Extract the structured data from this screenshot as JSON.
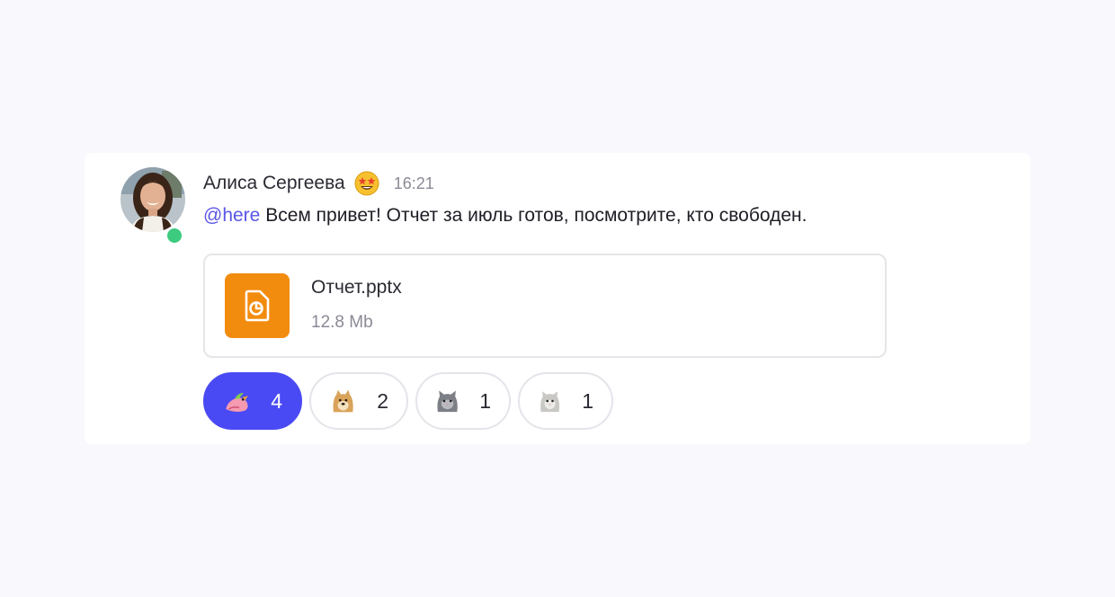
{
  "colors": {
    "background": "#f8f8fd",
    "card": "#ffffff",
    "accent": "#4a4af4",
    "mention": "#5a55e6",
    "online": "#3ccb7f",
    "file_icon_bg": "#f28c0f"
  },
  "message": {
    "author": "Алиса Сергеева",
    "author_status_emoji": "star-struck-emoji",
    "time": "16:21",
    "mention": "@here",
    "text": " Всем привет! Отчет за июль готов, посмотрите, кто свободен.",
    "online": true
  },
  "attachment": {
    "icon": "presentation-file-icon",
    "name": "Отчет.pptx",
    "size": "12.8 Mb"
  },
  "reactions": [
    {
      "emoji": "parrot-sticker",
      "count": "4",
      "active": true
    },
    {
      "emoji": "doge-sticker",
      "count": "2",
      "active": false
    },
    {
      "emoji": "grey-cat-sticker",
      "count": "1",
      "active": false
    },
    {
      "emoji": "white-cat-sticker",
      "count": "1",
      "active": false
    }
  ]
}
